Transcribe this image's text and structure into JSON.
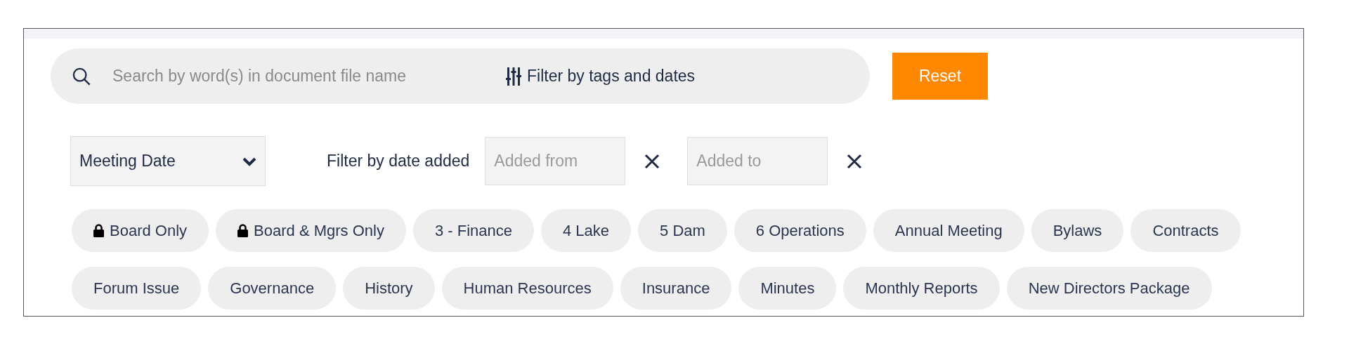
{
  "search": {
    "placeholder": "Search by word(s) in document file name"
  },
  "filter_toggle": {
    "label": "Filter by tags and dates"
  },
  "reset_button": {
    "label": "Reset"
  },
  "date_type": {
    "value": "Meeting Date"
  },
  "date_filter": {
    "label": "Filter by date added",
    "fields": [
      {
        "placeholder": "Added from"
      },
      {
        "placeholder": "Added to"
      }
    ]
  },
  "tag_rows": [
    [
      {
        "label": "Board Only",
        "locked": true
      },
      {
        "label": "Board & Mgrs Only",
        "locked": true
      },
      {
        "label": "3 - Finance",
        "locked": false
      },
      {
        "label": "4 Lake",
        "locked": false
      },
      {
        "label": "5 Dam",
        "locked": false
      },
      {
        "label": "6 Operations",
        "locked": false
      },
      {
        "label": "Annual Meeting",
        "locked": false
      },
      {
        "label": "Bylaws",
        "locked": false
      },
      {
        "label": "Contracts",
        "locked": false
      }
    ],
    [
      {
        "label": "Forum Issue",
        "locked": false
      },
      {
        "label": "Governance",
        "locked": false
      },
      {
        "label": "History",
        "locked": false
      },
      {
        "label": "Human Resources",
        "locked": false
      },
      {
        "label": "Insurance",
        "locked": false
      },
      {
        "label": "Minutes",
        "locked": false
      },
      {
        "label": "Monthly Reports",
        "locked": false
      },
      {
        "label": "New Directors Package",
        "locked": false
      }
    ]
  ]
}
